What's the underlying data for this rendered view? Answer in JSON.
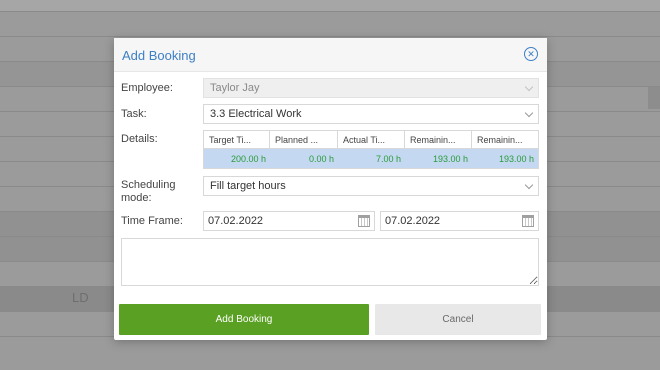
{
  "background": {
    "row_label": "LD"
  },
  "dialog": {
    "title": "Add Booking",
    "close_icon": "close-circle-icon",
    "employee": {
      "label": "Employee:",
      "value": "Taylor Jay"
    },
    "task": {
      "label": "Task:",
      "value": "3.3 Electrical Work"
    },
    "details": {
      "label": "Details:",
      "columns": [
        "Target Ti...",
        "Planned ...",
        "Actual Ti...",
        "Remainin...",
        "Remainin..."
      ],
      "values": [
        "200.00 h",
        "0.00 h",
        "7.00 h",
        "193.00 h",
        "193.00 h"
      ]
    },
    "scheduling_mode": {
      "label": "Scheduling mode:",
      "value": "Fill target hours"
    },
    "time_frame": {
      "label": "Time Frame:",
      "start": "07.02.2022",
      "end": "07.02.2022"
    },
    "notes": {
      "value": ""
    },
    "buttons": {
      "primary": "Add Booking",
      "secondary": "Cancel"
    }
  },
  "colors": {
    "accent": "#3d7fc4",
    "primary_button": "#5aa022",
    "value_green": "#2a9a3a",
    "details_row_bg": "#c4d9f1"
  }
}
